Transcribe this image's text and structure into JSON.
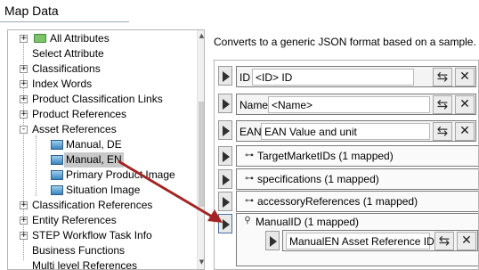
{
  "window": {
    "title": "Map Data"
  },
  "tree": {
    "items": [
      {
        "label": "All Attributes"
      },
      {
        "label": "Select Attribute"
      },
      {
        "label": "Classifications"
      },
      {
        "label": "Index Words"
      },
      {
        "label": "Product Classification Links"
      },
      {
        "label": "Product References"
      },
      {
        "label": "Asset References"
      },
      {
        "label": "Manual, DE"
      },
      {
        "label": "Manual, EN"
      },
      {
        "label": "Primary Product Image"
      },
      {
        "label": "Situation Image"
      },
      {
        "label": "Classification References"
      },
      {
        "label": "Entity References"
      },
      {
        "label": "STEP Workflow Task Info"
      },
      {
        "label": "Business Functions"
      },
      {
        "label": "Multi level References"
      }
    ],
    "expanders": {
      "plus": "+",
      "minus": "-"
    }
  },
  "description": "Converts to a generic JSON format based on a sample.",
  "mapping": {
    "rows": [
      {
        "field": "ID",
        "value": "<ID> ID"
      },
      {
        "field": "Name",
        "value": "<Name>"
      },
      {
        "field": "EAN",
        "value": "EAN Value and unit"
      }
    ],
    "objects": [
      {
        "label": "TargetMarketIDs (1 mapped)"
      },
      {
        "label": "specifications (1 mapped)"
      },
      {
        "label": "accessoryReferences (1 mapped)"
      },
      {
        "label": "ManualID (1 mapped)"
      }
    ],
    "nested": {
      "value": "ManualEN Asset Reference ID"
    },
    "buttons": {
      "map_glyph": "⇆",
      "delete_glyph": "✕"
    }
  },
  "icons": {
    "folder": "folder-icon",
    "asset": "image-asset-icon",
    "play": "play-icon",
    "key": "object-key-icon"
  },
  "colors": {
    "arrow": "#a32424",
    "selection": "#c8c8c8"
  }
}
